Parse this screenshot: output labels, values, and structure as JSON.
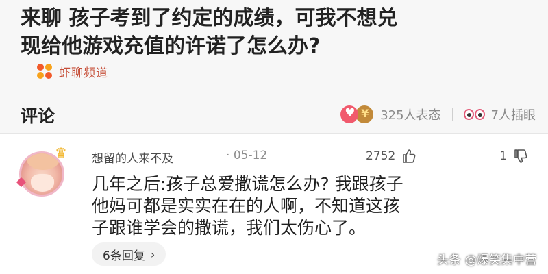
{
  "article": {
    "title_lines": [
      "来聊 孩子考到了约定的成绩，可我不想兑",
      "现给他游戏充值的许诺了怎么办?"
    ],
    "source_name": "虾聊频道",
    "source_logo": "four-dots-logo-icon"
  },
  "comment_bar": {
    "heading": "评论",
    "reactions_count": "325人表态",
    "reaction_icons": [
      "heart-emoji-icon",
      "money-emoji-icon"
    ],
    "watch_count": "7人插眼",
    "watch_icon": "eyes-icon"
  },
  "comment": {
    "username": "想留的人来不及",
    "separator": "·",
    "date": "05-12",
    "like_count": "2752",
    "dislike_count": "1",
    "text_lines": [
      "几年之后:孩子总爱撒谎怎么办? 我跟孩子",
      "他妈可都是实实在在的人啊，不知道这孩",
      "子跟谁学会的撒谎，我们太伤心了。"
    ],
    "reply_label": "6条回复",
    "reply_chevron": "›"
  },
  "watermark": "头条 @爆笑集中营",
  "colors": {
    "source_name": "#c7503a",
    "heart": "#f15a6d",
    "background_header": "#f7f7f7",
    "reply_bg": "#f2f2f2"
  }
}
